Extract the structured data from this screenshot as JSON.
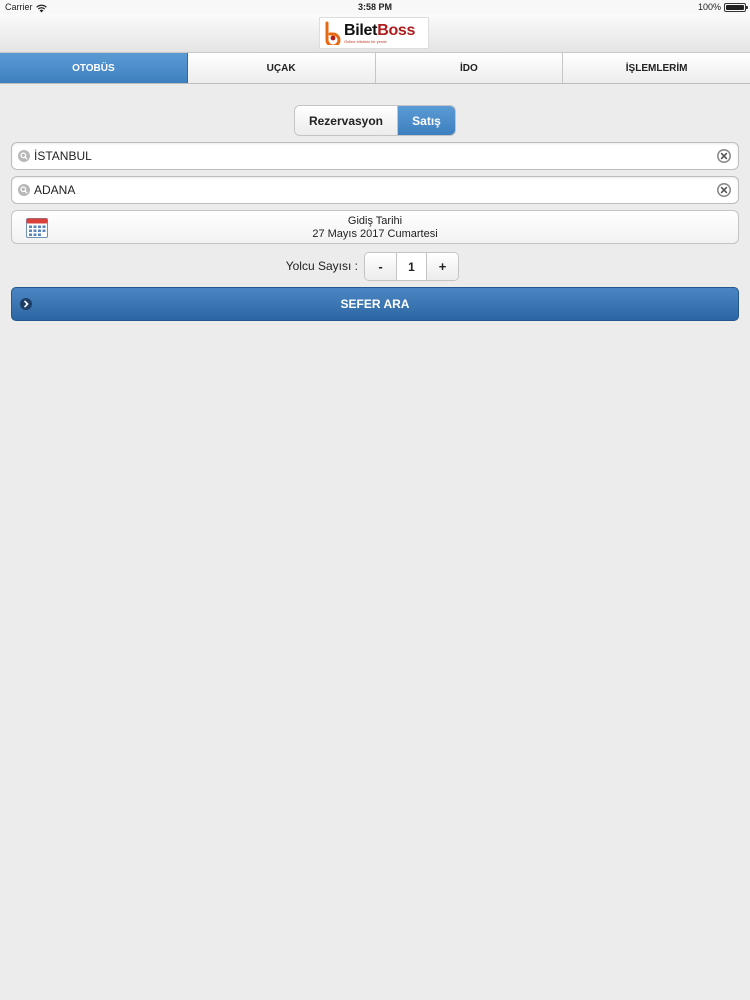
{
  "status_bar": {
    "carrier": "Carrier",
    "time": "3:58 PM",
    "battery": "100%",
    "battery_level": 1.0
  },
  "header": {
    "logo_part1": "Bilet",
    "logo_part2": "Boss",
    "logo_tagline": "Online biletiniz bir yerde"
  },
  "tabs": [
    {
      "label": "OTOBÜS",
      "active": true
    },
    {
      "label": "UÇAK",
      "active": false
    },
    {
      "label": "İDO",
      "active": false
    },
    {
      "label": "İŞLEMLERİM",
      "active": false
    }
  ],
  "mode_toggle": {
    "reservation_label": "Rezervasyon",
    "sale_label": "Satış",
    "selected": "Satış"
  },
  "route": {
    "from_value": "İSTANBUL",
    "to_value": "ADANA"
  },
  "date": {
    "label": "Gidiş Tarihi",
    "value": "27 Mayıs 2017 Cumartesi"
  },
  "passengers": {
    "label": "Yolcu Sayısı :",
    "minus": "-",
    "value": "1",
    "plus": "+"
  },
  "search_button": {
    "label": "SEFER ARA"
  },
  "colors": {
    "accent": "#4a8cca",
    "button": "#3a74b1",
    "brand_red": "#b01c1c",
    "background": "#ececec"
  }
}
